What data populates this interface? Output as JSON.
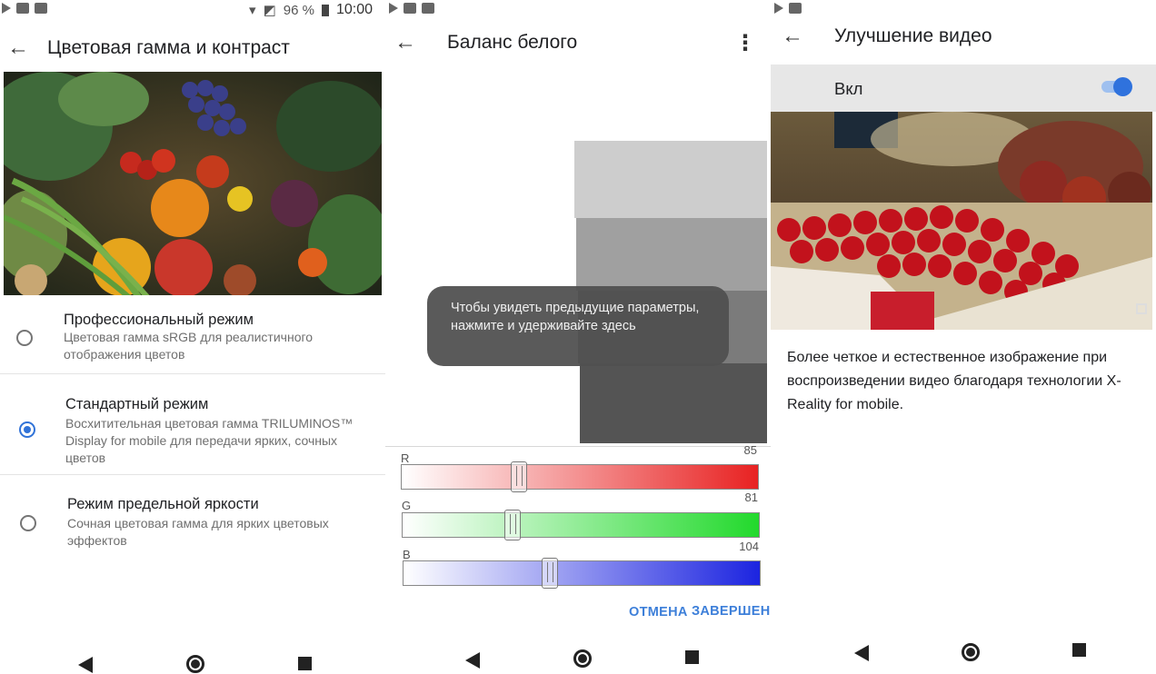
{
  "statusbar": {
    "battery": "96 %",
    "time": "10:00"
  },
  "panel1": {
    "title": "Цветовая гамма и контраст",
    "options": [
      {
        "title": "Профессиональный режим",
        "subtitle": "Цветовая гамма sRGB для реалистичного отображения цветов",
        "selected": false
      },
      {
        "title": "Стандартный режим",
        "subtitle": "Восхитительная цветовая гамма TRILUMINOS™ Display for mobile для передачи ярких, сочных цветов",
        "selected": true
      },
      {
        "title": "Режим предельной яркости",
        "subtitle": "Сочная цветовая гамма для ярких цветовых эффектов",
        "selected": false
      }
    ]
  },
  "panel2": {
    "title": "Баланс белого",
    "toast": "Чтобы увидеть предыдущие параметры, нажмите и удерживайте здесь",
    "sliders": [
      {
        "label": "R",
        "value": "85",
        "level": 0.33,
        "color": "#e82222"
      },
      {
        "label": "G",
        "value": "81",
        "level": 0.31,
        "color": "#22d92c"
      },
      {
        "label": "B",
        "value": "104",
        "level": 0.41,
        "color": "#1c24e0"
      }
    ],
    "cancel_label": "ОТМЕНА",
    "done_label": "ЗАВЕРШЕНО"
  },
  "panel3": {
    "title": "Улучшение видео",
    "switch_label": "Вкл",
    "switch_on": true,
    "description": "Более четкое и естественное изображение при воспроизведении видео благодаря технологии X-Reality for mobile."
  },
  "colors": {
    "accent": "#3173d8",
    "link": "#3d7fd9",
    "toast_bg": "#505050"
  }
}
